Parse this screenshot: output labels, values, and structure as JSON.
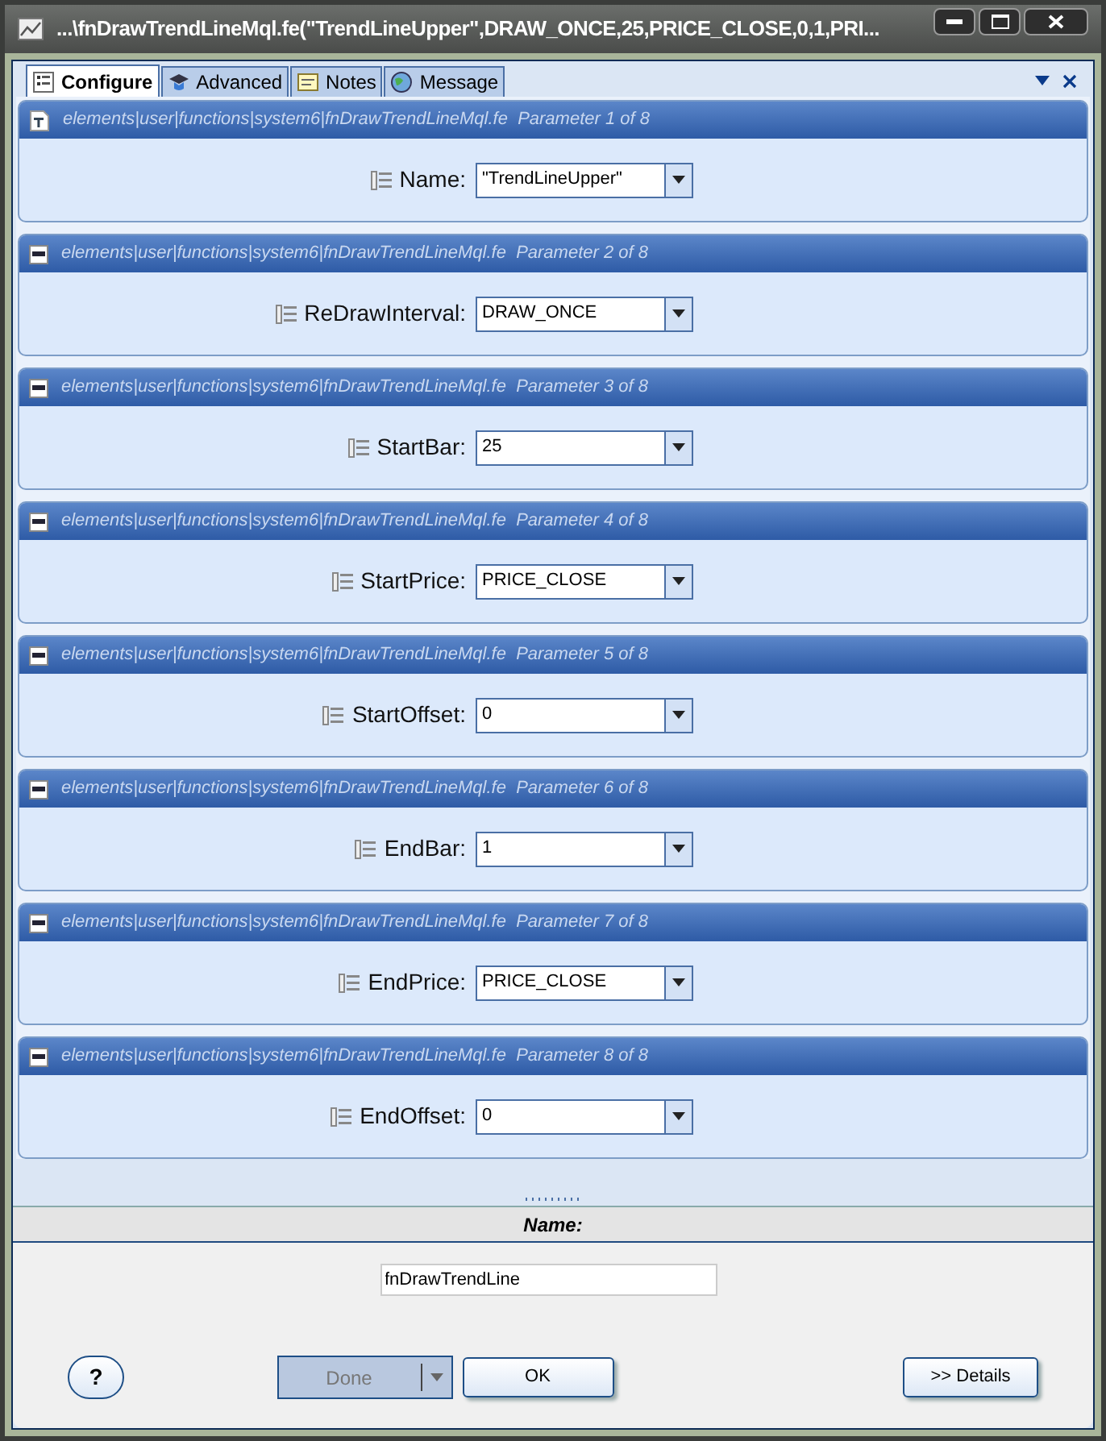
{
  "window": {
    "title": "...\\fnDrawTrendLineMql.fe(\"TrendLineUpper\",DRAW_ONCE,25,PRICE_CLOSE,0,1,PRI..."
  },
  "tabs": [
    {
      "label": "Configure",
      "selected": true,
      "kind": "form"
    },
    {
      "label": "Advanced",
      "selected": false,
      "kind": "cap"
    },
    {
      "label": "Notes",
      "selected": false,
      "kind": "note"
    },
    {
      "label": "Message",
      "selected": false,
      "kind": "globe"
    }
  ],
  "parameters": [
    {
      "header": "elements|user|functions|system6|fnDrawTrendLineMql.fe  Parameter 1 of 8",
      "kind": "document",
      "label": "Name:",
      "value": "\"TrendLineUpper\""
    },
    {
      "header": "elements|user|functions|system6|fnDrawTrendLineMql.fe  Parameter 2 of 8",
      "kind": "collapse",
      "label": "ReDrawInterval:",
      "value": "DRAW_ONCE"
    },
    {
      "header": "elements|user|functions|system6|fnDrawTrendLineMql.fe  Parameter 3 of 8",
      "kind": "collapse",
      "label": "StartBar:",
      "value": "25"
    },
    {
      "header": "elements|user|functions|system6|fnDrawTrendLineMql.fe  Parameter 4 of 8",
      "kind": "collapse",
      "label": "StartPrice:",
      "value": "PRICE_CLOSE"
    },
    {
      "header": "elements|user|functions|system6|fnDrawTrendLineMql.fe  Parameter 5 of 8",
      "kind": "collapse",
      "label": "StartOffset:",
      "value": "0"
    },
    {
      "header": "elements|user|functions|system6|fnDrawTrendLineMql.fe  Parameter 6 of 8",
      "kind": "collapse",
      "label": "EndBar:",
      "value": "1"
    },
    {
      "header": "elements|user|functions|system6|fnDrawTrendLineMql.fe  Parameter 7 of 8",
      "kind": "collapse",
      "label": "EndPrice:",
      "value": "PRICE_CLOSE"
    },
    {
      "header": "elements|user|functions|system6|fnDrawTrendLineMql.fe  Parameter 8 of 8",
      "kind": "collapse",
      "label": "EndOffset:",
      "value": "0"
    }
  ],
  "name_section": {
    "heading": "Name:",
    "value": "fnDrawTrendLine"
  },
  "buttons": {
    "help": {
      "label": "?"
    },
    "done": {
      "label": "Done",
      "disabled": true
    },
    "ok": {
      "label": "OK"
    },
    "details": {
      "label": ">> Details"
    }
  }
}
